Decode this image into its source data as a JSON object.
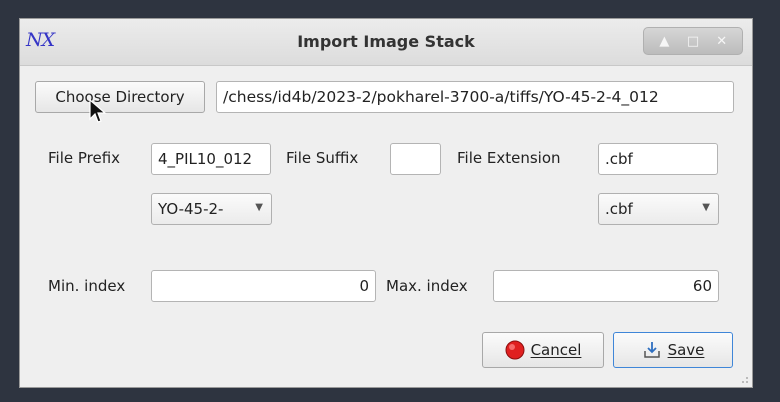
{
  "window": {
    "logo": "NX",
    "title": "Import Image Stack"
  },
  "title_controls": [
    "up-arrow-icon",
    "maximize-icon",
    "close-icon"
  ],
  "directory": {
    "button_label": "Choose Directory",
    "path": "/chess/id4b/2023-2/pokharel-3700-a/tiffs/YO-45-2-4_012"
  },
  "files": {
    "prefix_label": "File Prefix",
    "prefix_value": "4_PIL10_012",
    "suffix_label": "File Suffix",
    "suffix_value": "",
    "extension_label": "File Extension",
    "extension_value": ".cbf",
    "prefix_combo": "YO-45-2-",
    "extension_combo": ".cbf"
  },
  "index": {
    "min_label": "Min. index",
    "min_value": "0",
    "max_label": "Max. index",
    "max_value": "60"
  },
  "actions": {
    "cancel_label": "Cancel",
    "save_label": "Save"
  },
  "colors": {
    "cancel_icon": "#e02020",
    "save_outline": "#3f86d8"
  }
}
